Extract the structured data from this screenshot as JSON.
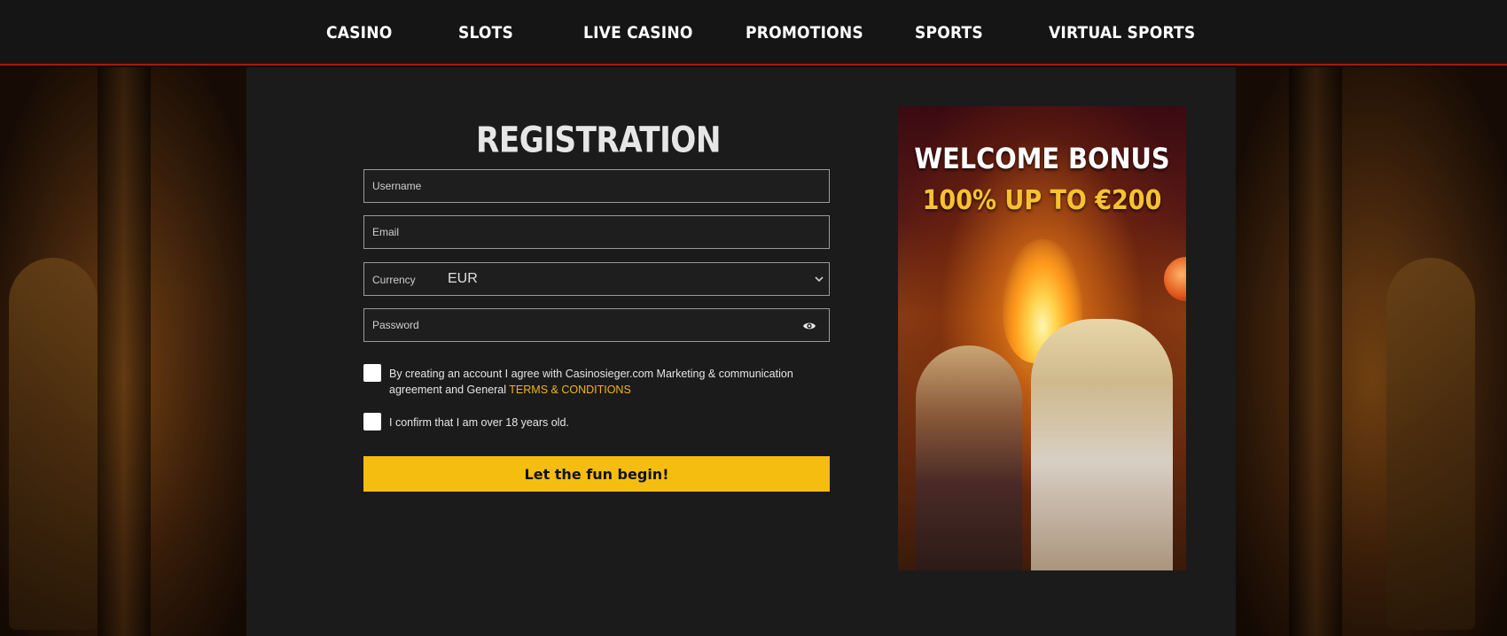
{
  "nav": {
    "items": [
      {
        "label": "CASINO"
      },
      {
        "label": "SLOTS"
      },
      {
        "label": "LIVE CASINO"
      },
      {
        "label": "PROMOTIONS"
      },
      {
        "label": "SPORTS"
      },
      {
        "label": "VIRTUAL SPORTS"
      }
    ]
  },
  "registration": {
    "title": "REGISTRATION",
    "username_placeholder": "Username",
    "email_placeholder": "Email",
    "currency_label": "Currency",
    "currency_value": "EUR",
    "password_placeholder": "Password",
    "password_toggle_icon": "eye-icon",
    "consent_text": "By creating an account I agree with Casinosieger.com Marketing & communication agreement and General",
    "terms_link": "TERMS & CONDITIONS",
    "age_text": "I confirm that I am over 18 years old.",
    "submit_label": "Let the fun begin!"
  },
  "banner": {
    "line1": "WELCOME BONUS",
    "line2": "100% UP TO €200"
  },
  "colors": {
    "accent": "#f5bd10",
    "nav_border": "#a51a0e",
    "panel": "#1b1b1b",
    "link": "#f0b51c"
  }
}
